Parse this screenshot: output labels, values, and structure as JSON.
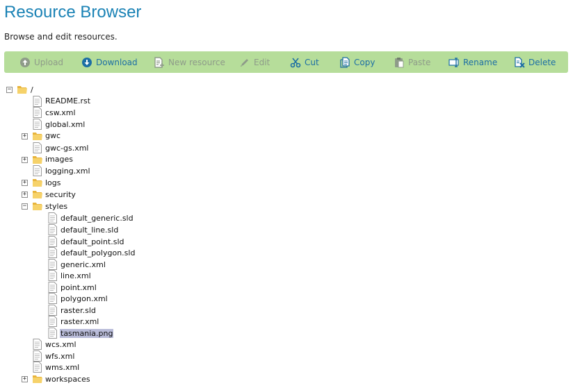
{
  "page": {
    "title": "Resource Browser",
    "subtitle": "Browse and edit resources."
  },
  "toolbar": {
    "upload": "Upload",
    "download": "Download",
    "new_resource": "New resource",
    "edit": "Edit",
    "cut": "Cut",
    "copy": "Copy",
    "paste": "Paste",
    "rename": "Rename",
    "delete": "Delete"
  },
  "tree": {
    "root": "/",
    "readme": "README.rst",
    "csw": "csw.xml",
    "global": "global.xml",
    "gwc": "gwc",
    "gwc_gs": "gwc-gs.xml",
    "images": "images",
    "logging": "logging.xml",
    "logs": "logs",
    "security": "security",
    "styles": "styles",
    "styles_children": {
      "default_generic": "default_generic.sld",
      "default_line": "default_line.sld",
      "default_point": "default_point.sld",
      "default_polygon": "default_polygon.sld",
      "generic": "generic.xml",
      "line": "line.xml",
      "point": "point.xml",
      "polygon": "polygon.xml",
      "raster_sld": "raster.sld",
      "raster_xml": "raster.xml",
      "tasmania": "tasmania.png"
    },
    "wcs": "wcs.xml",
    "wfs": "wfs.xml",
    "wms": "wms.xml",
    "workspaces": "workspaces",
    "selected": "tasmania.png"
  },
  "colors": {
    "title": "#1a82b5",
    "toolbar_bg": "#b6dd9a",
    "enabled_text": "#1c6ea4",
    "disabled_text": "#8e9b89",
    "selection": "#b9bcd9"
  }
}
